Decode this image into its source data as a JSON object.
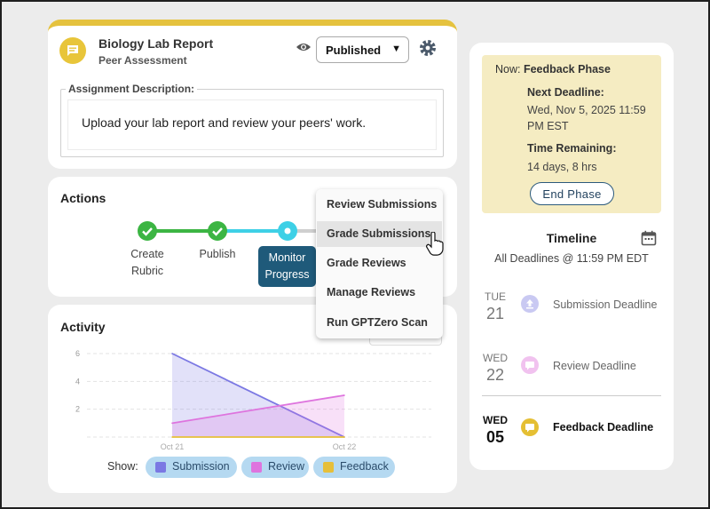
{
  "assignment": {
    "title": "Biology Lab Report",
    "subtitle": "Peer Assessment",
    "status_value": "Published",
    "description_label": "Assignment Description:",
    "description_text": "Upload your lab report and review your peers' work."
  },
  "actions": {
    "title": "Actions",
    "steps": [
      {
        "label_line1": "Create",
        "label_line2": "Rubric",
        "state": "done"
      },
      {
        "label_line1": "Publish",
        "label_line2": "",
        "state": "done"
      },
      {
        "label_line1": "Monitor",
        "label_line2": "Progress",
        "state": "active"
      }
    ],
    "menu": [
      "Review Submissions",
      "Grade Submissions",
      "Grade Reviews",
      "Manage Reviews",
      "Run GPTZero Scan"
    ],
    "menu_highlighted_index": 1
  },
  "activity": {
    "title": "Activity",
    "show_label": "Show:",
    "toggles": [
      {
        "label": "Submission",
        "color": "#7b78e3"
      },
      {
        "label": "Review",
        "color": "#de74de"
      },
      {
        "label": "Feedback",
        "color": "#e6bf3a"
      }
    ]
  },
  "chart_data": {
    "type": "area",
    "x": [
      "Oct 21",
      "Oct 22"
    ],
    "yticks": [
      2,
      4,
      6
    ],
    "ylim": [
      0,
      6
    ],
    "series": [
      {
        "name": "Submission",
        "values": [
          6,
          0
        ],
        "color": "#7b78e3"
      },
      {
        "name": "Review",
        "values": [
          1,
          3
        ],
        "color": "#de74de"
      },
      {
        "name": "Feedback",
        "values": [
          0,
          0
        ],
        "color": "#e6bf3a"
      }
    ]
  },
  "phase": {
    "now_label": "Now:",
    "now_value": "Feedback Phase",
    "next_deadline_label": "Next Deadline:",
    "next_deadline_line1": "Wed, Nov 5, 2025 11:59",
    "next_deadline_line2": "PM EST",
    "time_remaining_label": "Time Remaining:",
    "time_remaining_value": "14 days, 8 hrs",
    "end_button": "End Phase"
  },
  "timeline": {
    "title": "Timeline",
    "subtitle": "All Deadlines @ 11:59 PM EDT",
    "items": [
      {
        "day": "TUE",
        "date": "21",
        "label": "Submission Deadline",
        "icon": "upload-icon",
        "current": false
      },
      {
        "day": "WED",
        "date": "22",
        "label": "Review Deadline",
        "icon": "review-icon",
        "current": false
      },
      {
        "day": "WED",
        "date": "05",
        "label": "Feedback Deadline",
        "icon": "feedback-icon",
        "current": true
      }
    ]
  }
}
